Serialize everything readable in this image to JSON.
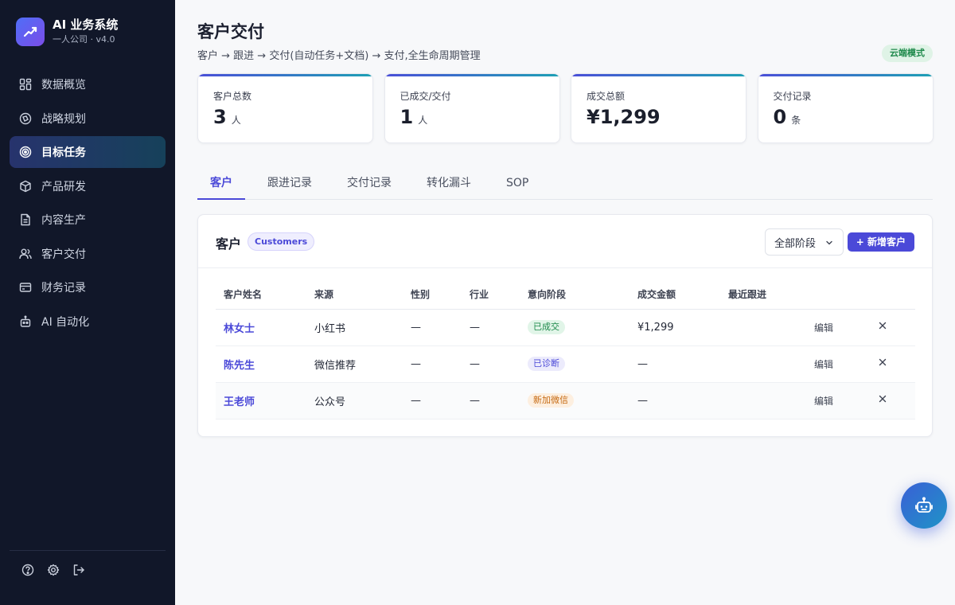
{
  "brand": {
    "title": "AI 业务系统",
    "subtitle": "一人公司 · v4.0",
    "logo_icon": "trend-up-icon"
  },
  "sidebar": {
    "items": [
      {
        "label": "数据概览",
        "icon": "grid-icon",
        "active": false
      },
      {
        "label": "战略规划",
        "icon": "compass-icon",
        "active": false
      },
      {
        "label": "目标任务",
        "icon": "target-icon",
        "active": true
      },
      {
        "label": "产品研发",
        "icon": "box-icon",
        "active": false
      },
      {
        "label": "内容生产",
        "icon": "document-icon",
        "active": false
      },
      {
        "label": "客户交付",
        "icon": "users-icon",
        "active": false
      },
      {
        "label": "财务记录",
        "icon": "wallet-icon",
        "active": false
      },
      {
        "label": "AI 自动化",
        "icon": "bot-icon",
        "active": false
      }
    ],
    "footer_icons": [
      "help-icon",
      "settings-icon",
      "logout-icon"
    ]
  },
  "header": {
    "title": "客户交付",
    "subtitle": "客户 → 跟进 → 交付(自动任务+文档) → 支付,全生命周期管理",
    "mode_badge": "云端模式"
  },
  "stats": [
    {
      "label": "客户总数",
      "value": "3",
      "unit": "人"
    },
    {
      "label": "已成交/交付",
      "value": "1",
      "unit": "人"
    },
    {
      "label": "成交总额",
      "value": "¥1,299",
      "unit": ""
    },
    {
      "label": "交付记录",
      "value": "0",
      "unit": "条"
    }
  ],
  "tabs": [
    {
      "label": "客户",
      "active": true
    },
    {
      "label": "跟进记录",
      "active": false
    },
    {
      "label": "交付记录",
      "active": false
    },
    {
      "label": "转化漏斗",
      "active": false
    },
    {
      "label": "SOP",
      "active": false
    }
  ],
  "panel": {
    "title": "客户",
    "tag": "Customers",
    "stage_filter": "全部阶段",
    "add_button": "+ 新增客户"
  },
  "table": {
    "columns": [
      "客户姓名",
      "来源",
      "性别",
      "行业",
      "意向阶段",
      "成交金额",
      "最近跟进"
    ],
    "rows": [
      {
        "name": "林女士",
        "source": "小红书",
        "gender": "—",
        "industry": "—",
        "stage": "已成交",
        "stage_color": "#1f8a4c",
        "stage_bg": "#e1f5e8",
        "amount": "¥1,299",
        "last_follow": "",
        "edit": "编辑"
      },
      {
        "name": "陈先生",
        "source": "微信推荐",
        "gender": "—",
        "industry": "—",
        "stage": "已诊断",
        "stage_color": "#4b49d8",
        "stage_bg": "#ecebfc",
        "amount": "—",
        "last_follow": "",
        "edit": "编辑"
      },
      {
        "name": "王老师",
        "source": "公众号",
        "gender": "—",
        "industry": "—",
        "stage": "新加微信",
        "stage_color": "#c66a12",
        "stage_bg": "#fdefe0",
        "amount": "—",
        "last_follow": "",
        "edit": "编辑"
      }
    ]
  },
  "colors": {
    "accent": "#4b49d8",
    "sidebar_bg": "#111729",
    "success": "#1f8a4c"
  },
  "fab_icon": "robot-icon"
}
